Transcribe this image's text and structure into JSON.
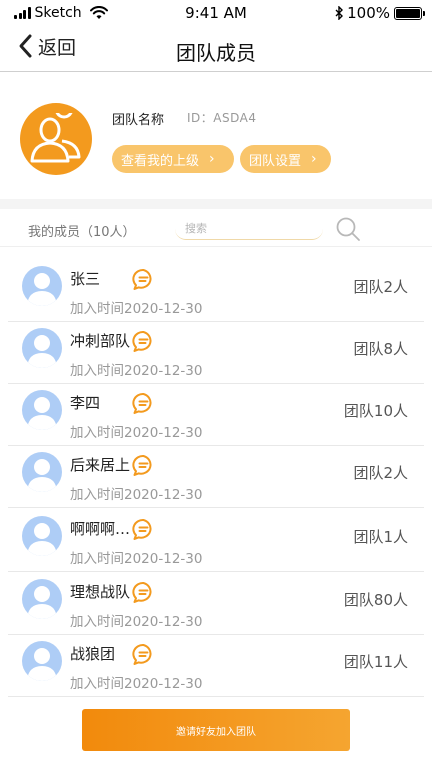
{
  "status_bar": {
    "carrier": "Sketch",
    "time": "9:41 AM",
    "battery": "100%"
  },
  "nav": {
    "back_label": "返回",
    "title": "团队成员"
  },
  "team": {
    "name": "团队名称",
    "id_text": "ID：ASDA4",
    "superior_button": "查看我的上级",
    "settings_button": "团队设置"
  },
  "members_bar": {
    "label": "我的成员（10人）",
    "search_placeholder": "搜索"
  },
  "members": [
    {
      "name": "张三",
      "join_time": "加入时间2020-12-30",
      "team_count": "团队2人"
    },
    {
      "name": "冲刺部队",
      "join_time": "加入时间2020-12-30",
      "team_count": "团队8人"
    },
    {
      "name": "李四",
      "join_time": "加入时间2020-12-30",
      "team_count": "团队10人"
    },
    {
      "name": "后来居上",
      "join_time": "加入时间2020-12-30",
      "team_count": "团队2人"
    },
    {
      "name": "啊啊啊…",
      "join_time": "加入时间2020-12-30",
      "team_count": "团队1人"
    },
    {
      "name": "理想战队",
      "join_time": "加入时间2020-12-30",
      "team_count": "团队80人"
    },
    {
      "name": "战狼团",
      "join_time": "加入时间2020-12-30",
      "team_count": "团队11人"
    }
  ],
  "invite_button": "邀请好友加入团队",
  "colors": {
    "accent": "#f39a1e",
    "chip": "#f9c56b",
    "avatar_blue": "#aecdf6"
  },
  "icons": {
    "chat": "chat-bubble-icon",
    "search": "search-icon",
    "team_avatar": "people-icon",
    "back": "chevron-left-icon"
  }
}
